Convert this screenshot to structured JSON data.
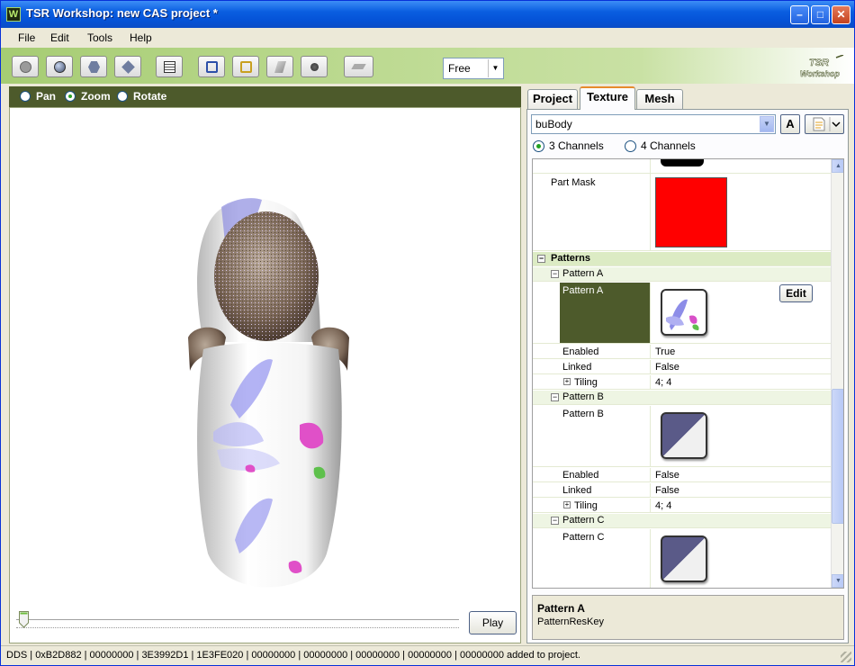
{
  "window": {
    "title": "TSR Workshop: new CAS project *"
  },
  "menu": [
    "File",
    "Edit",
    "Tools",
    "Help"
  ],
  "toolbar": {
    "view_mode": "Free"
  },
  "logo": {
    "line1": "TSR",
    "line2": "Workshop"
  },
  "viewport": {
    "nav_modes": [
      {
        "label": "Pan",
        "selected": false
      },
      {
        "label": "Zoom",
        "selected": true
      },
      {
        "label": "Rotate",
        "selected": false
      }
    ],
    "play_label": "Play"
  },
  "tabs": [
    {
      "label": "Project",
      "active": false
    },
    {
      "label": "Texture",
      "active": true
    },
    {
      "label": "Mesh",
      "active": false
    }
  ],
  "texture": {
    "part": "buBody",
    "font_button": "A",
    "channels": [
      {
        "label": "3 Channels",
        "selected": true
      },
      {
        "label": "4 Channels",
        "selected": false
      }
    ]
  },
  "grid": {
    "part_mask_label": "Part Mask",
    "part_mask_color": "#ff0000",
    "category": "Patterns",
    "edit_label": "Edit",
    "patterns": [
      {
        "header": "Pattern A",
        "name": "Pattern A",
        "enabled_label": "Enabled",
        "enabled": "True",
        "linked_label": "Linked",
        "linked": "False",
        "tiling_label": "Tiling",
        "tiling": "4; 4"
      },
      {
        "header": "Pattern B",
        "name": "Pattern B",
        "enabled_label": "Enabled",
        "enabled": "False",
        "linked_label": "Linked",
        "linked": "False",
        "tiling_label": "Tiling",
        "tiling": "4; 4"
      },
      {
        "header": "Pattern C",
        "name": "Pattern C"
      }
    ]
  },
  "description": {
    "title": "Pattern A",
    "text": "PatternResKey"
  },
  "status": "DDS | 0xB2D882 | 00000000 | 3E3992D1 | 1E3FE020 | 00000000 | 00000000 | 00000000 | 00000000 | 00000000 added to project.",
  "colors": {
    "accent_green": "#4d5a2b",
    "selected_cell": "#4d5a2b",
    "tab_highlight": "#e68b2c"
  }
}
